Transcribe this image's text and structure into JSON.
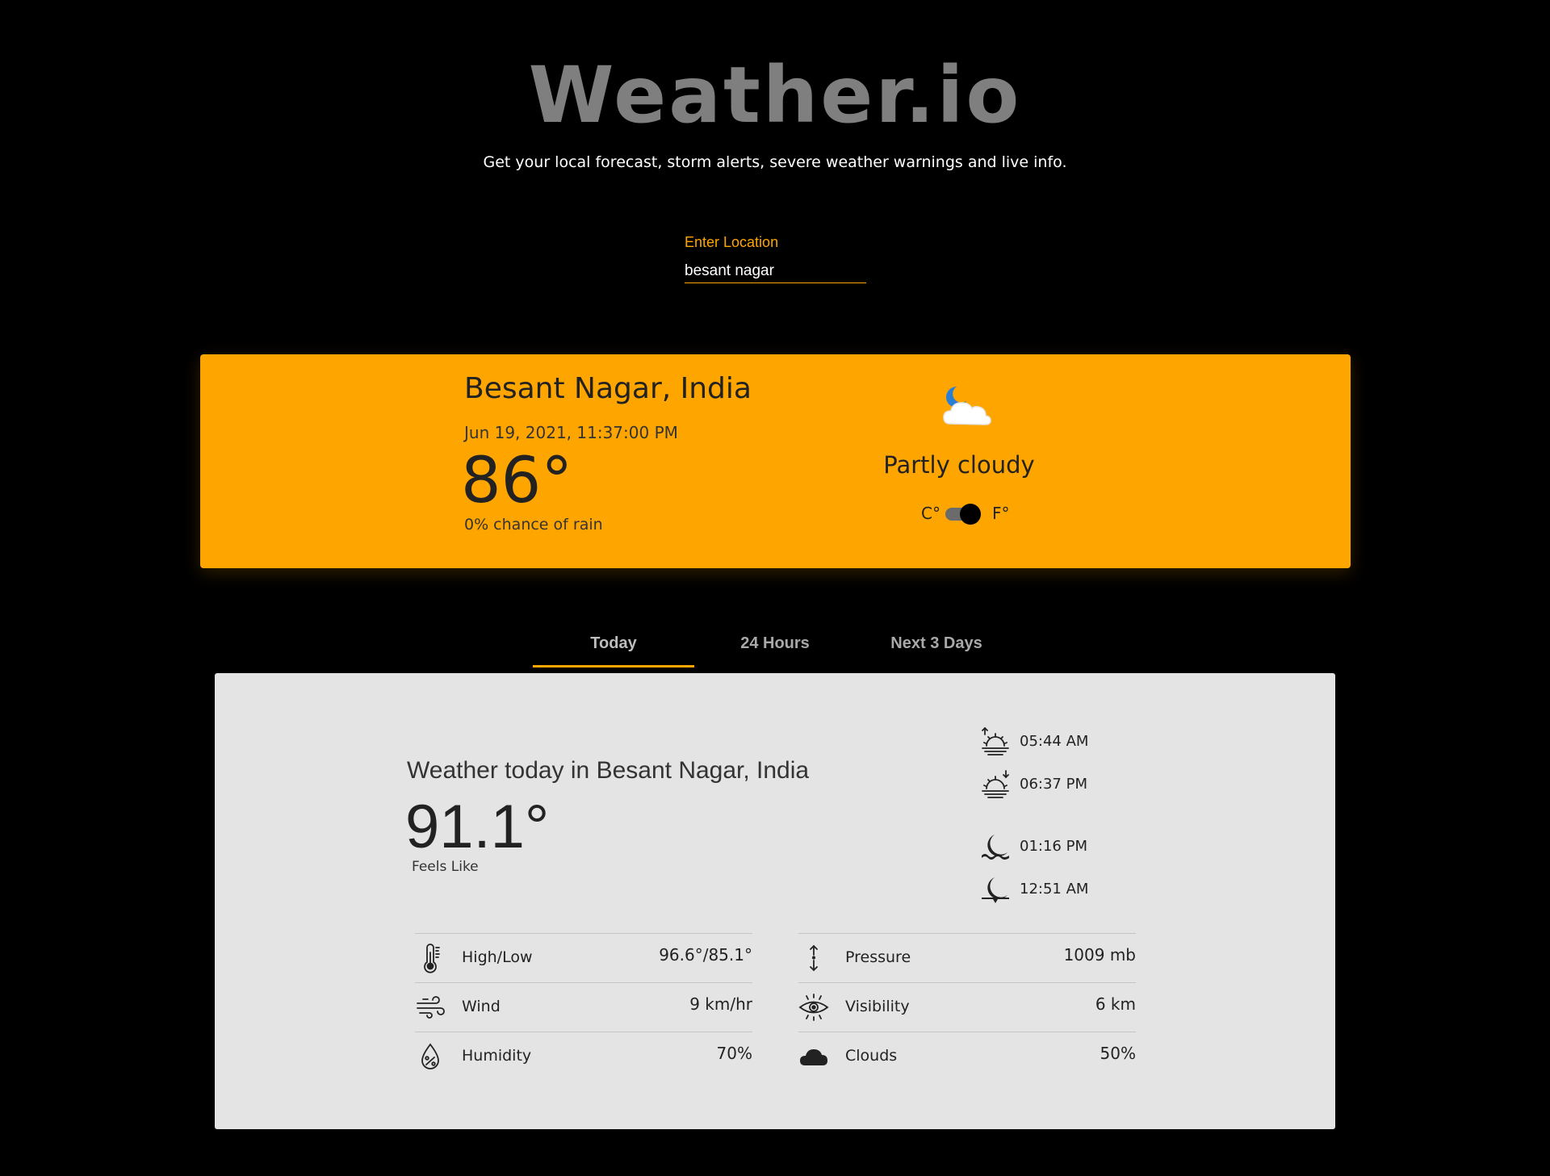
{
  "header": {
    "title": "Weather.io",
    "tagline": "Get your local forecast, storm alerts, severe weather warnings and live info."
  },
  "search": {
    "label": "Enter Location",
    "value": "besant nagar"
  },
  "current": {
    "location": "Besant Nagar, India",
    "datetime": "Jun 19, 2021, 11:37:00 PM",
    "temperature": "86°",
    "rain_chance": "0% chance of rain",
    "condition": "Partly cloudy",
    "condition_icon": "partly-cloudy-night-icon",
    "unit_c": "C°",
    "unit_f": "F°",
    "unit_selected": "F°"
  },
  "tabs": [
    {
      "label": "Today",
      "active": true
    },
    {
      "label": "24 Hours",
      "active": false
    },
    {
      "label": "Next 3 Days",
      "active": false
    }
  ],
  "today": {
    "heading": "Weather today in Besant Nagar, India",
    "feels_like_value": "91.1°",
    "feels_like_label": "Feels Like",
    "astro": [
      {
        "icon": "sunrise-icon",
        "time": "05:44 AM"
      },
      {
        "icon": "sunset-icon",
        "time": "06:37 PM"
      },
      {
        "icon": "moonrise-icon",
        "time": "01:16 PM"
      },
      {
        "icon": "moonset-icon",
        "time": "12:51 AM"
      }
    ],
    "details_left": [
      {
        "icon": "thermometer-icon",
        "label": "High/Low",
        "value": "96.6°/85.1°"
      },
      {
        "icon": "wind-icon",
        "label": "Wind",
        "value": "9 km/hr"
      },
      {
        "icon": "humidity-icon",
        "label": "Humidity",
        "value": "70%"
      }
    ],
    "details_right": [
      {
        "icon": "pressure-icon",
        "label": "Pressure",
        "value": "1009 mb"
      },
      {
        "icon": "visibility-icon",
        "label": "Visibility",
        "value": "6 km"
      },
      {
        "icon": "clouds-icon",
        "label": "Clouds",
        "value": "50%"
      }
    ]
  },
  "colors": {
    "background": "#000000",
    "accent": "#ffa500",
    "card_light": "#e4e4e4",
    "title_gray": "#7f7f7f"
  }
}
